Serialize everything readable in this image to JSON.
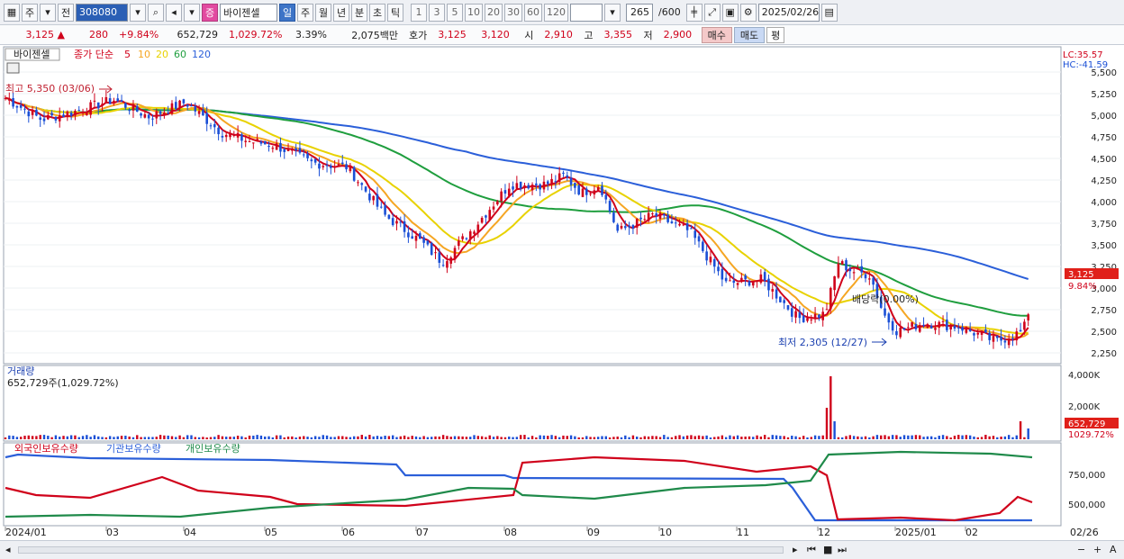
{
  "toolbar": {
    "type_label": "주",
    "prev_label": "전",
    "code": "308080",
    "badge": "증",
    "stock_name": "바이젠셀",
    "periods": [
      "일",
      "주",
      "월",
      "년",
      "분",
      "초",
      "틱"
    ],
    "active_period": "일",
    "numbers": [
      "1",
      "3",
      "5",
      "10",
      "20",
      "30",
      "60",
      "120"
    ],
    "count": "265",
    "total": "/600",
    "date": "2025/02/26"
  },
  "quote": {
    "price": "3,125 ▲",
    "change": "280",
    "change_pct": "+9.84%",
    "volume": "652,729",
    "volume_pct": "1,029.72%",
    "turnover_pct": "3.39%",
    "trade_value": "2,075백만",
    "ask_label": "호가",
    "ask": "3,125",
    "bid": "3,120",
    "open_label": "시",
    "open": "2,910",
    "high_label": "고",
    "high": "3,355",
    "low_label": "저",
    "low": "2,900",
    "buy_label": "매수",
    "sell_label": "매도",
    "avg_label": "평"
  },
  "price_panel": {
    "name_tag": "바이젠셀",
    "ma_label": "종가 단순",
    "ma_periods": [
      {
        "label": "5",
        "color": "#d0021b"
      },
      {
        "label": "10",
        "color": "#f5a623"
      },
      {
        "label": "20",
        "color": "#e8d200"
      },
      {
        "label": "60",
        "color": "#1f9e3e"
      },
      {
        "label": "120",
        "color": "#2b5fd9"
      }
    ],
    "lc": "LC:35.57",
    "hc": "HC:-41.59",
    "y_ticks": [
      "5,500",
      "5,250",
      "5,000",
      "4,750",
      "4,500",
      "4,250",
      "4,000",
      "3,750",
      "3,500",
      "3,250",
      "3,000",
      "2,750",
      "2,500",
      "2,250"
    ],
    "price_tag": "3,125",
    "pct_tag": "9.84%",
    "high_note": "최고 5,350 (03/06)",
    "low_note": "최저 2,305 (12/27)",
    "dividend_note": "배당락(0.00%)"
  },
  "volume_panel": {
    "title": "거래량",
    "value": "652,729주(1,029.72%)",
    "y_ticks": [
      "4,000K",
      "2,000K"
    ],
    "vol_tag": "652,729",
    "vol_pct_tag": "1029.72%"
  },
  "holding_panel": {
    "series": [
      {
        "label": "외국인보유수량",
        "color": "#d0021b"
      },
      {
        "label": "기관보유수량",
        "color": "#2b5fd9"
      },
      {
        "label": "개인보유수량",
        "color": "#1f8a4a"
      }
    ],
    "y_ticks": [
      "750,000",
      "500,000"
    ]
  },
  "x_axis": {
    "labels": [
      "2024/01",
      "03",
      "04",
      "05",
      "06",
      "07",
      "08",
      "09",
      "10",
      "11",
      "12",
      "2025/01",
      "02"
    ],
    "right_label": "02/26"
  },
  "colors": {
    "up": "#d0021b",
    "down": "#1a4fd6",
    "accent": "#3d74c7"
  }
}
